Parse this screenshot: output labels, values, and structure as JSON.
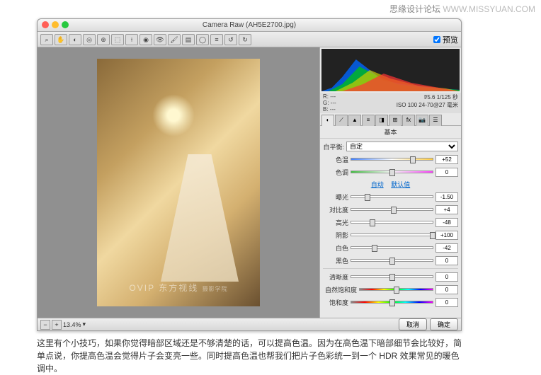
{
  "watermark": {
    "site": "思缘设计论坛",
    "url": "WWW.MISSYUAN.COM"
  },
  "window": {
    "title": "Camera Raw (AH5E2700.jpg)"
  },
  "toolbar": {
    "preview_label": "预览"
  },
  "meta": {
    "r": "R: ---",
    "g": "G: ---",
    "b": "B: ---",
    "fstop": "f/5.6",
    "shutter": "1/125 秒",
    "iso": "ISO 100",
    "lens": "24-70@27 毫米"
  },
  "panel": {
    "tab_title": "基本"
  },
  "wb": {
    "label": "白平衡:",
    "value": "自定"
  },
  "links": {
    "auto": "自动",
    "default": "默认值"
  },
  "sliders": {
    "temp": {
      "label": "色温",
      "value": "+52",
      "pos": 76
    },
    "tint": {
      "label": "色调",
      "value": "0",
      "pos": 50
    },
    "exposure": {
      "label": "曝光",
      "value": "-1.50",
      "pos": 20
    },
    "contrast": {
      "label": "对比度",
      "value": "+4",
      "pos": 52
    },
    "highlights": {
      "label": "高光",
      "value": "-48",
      "pos": 26
    },
    "shadows": {
      "label": "阴影",
      "value": "+100",
      "pos": 100
    },
    "whites": {
      "label": "白色",
      "value": "-42",
      "pos": 29
    },
    "blacks": {
      "label": "黑色",
      "value": "0",
      "pos": 50
    },
    "clarity": {
      "label": "清晰度",
      "value": "0",
      "pos": 50
    },
    "vibrance": {
      "label": "自然饱和度",
      "value": "0",
      "pos": 50
    },
    "saturation": {
      "label": "饱和度",
      "value": "0",
      "pos": 50
    }
  },
  "footer": {
    "zoom": "13.4%",
    "cancel": "取消",
    "ok": "确定"
  },
  "ovip": {
    "big": "OVIP 东方视线",
    "small": "摄影学院"
  },
  "article": {
    "text": "这里有个小技巧，如果你觉得暗部区域还是不够清楚的话，可以提高色温。因为在高色温下暗部细节会比较好，简单点说，你提高色温会觉得片子会变亮一些。同时提高色温也帮我们把片子色彩统一到一个 HDR 效果常见的暖色调中。"
  }
}
